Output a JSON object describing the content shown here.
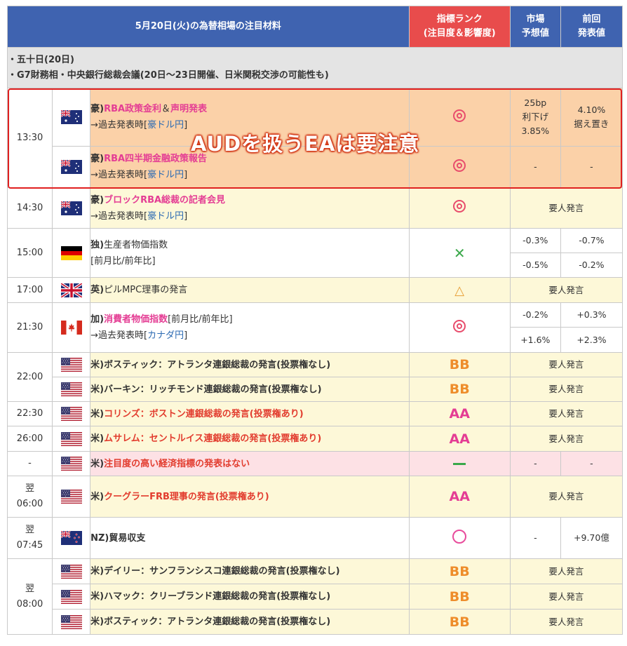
{
  "header": {
    "title": "5月20日(火)の為替相場の注目材料",
    "rank_line1": "指標ランク",
    "rank_line2": "(注目度＆影響度)",
    "forecast_line1": "市場",
    "forecast_line2": "予想値",
    "prev_line1": "前回",
    "prev_line2": "発表値"
  },
  "notes": {
    "line1": "・五十日(20日)",
    "line2": "・G7財務相・中央銀行総裁会議(20日～23日開催、日米関税交渉の可能性も)"
  },
  "overlay_text": "AUDを扱うEAは要注意",
  "events": {
    "rba_rate": {
      "time": "13:30",
      "country": "豪)",
      "title": "RBA政策金利",
      "mid": "＆",
      "title2": "声明発表",
      "sub_pre": "→過去発表時[",
      "sub_link": "豪ドル円",
      "sub_post": "]",
      "forecast": [
        "25bp",
        "利下げ",
        "3.85%"
      ],
      "previous": [
        "4.10%",
        "据え置き"
      ]
    },
    "rba_report": {
      "country": "豪)",
      "title": "RBA四半期金融政策報告",
      "sub_pre": "→過去発表時[",
      "sub_link": "豪ドル円",
      "sub_post": "]",
      "forecast": "-",
      "previous": "-"
    },
    "bullock": {
      "time": "14:30",
      "country": "豪)",
      "title": "ブロックRBA総裁の記者会見",
      "sub_pre": "→過去発表時[",
      "sub_link": "豪ドル円",
      "sub_post": "]",
      "vip": "要人発言"
    },
    "de_ppi": {
      "time": "15:00",
      "country": "独)",
      "title": "生産者物価指数",
      "sub": "[前月比/前年比]",
      "forecast": [
        "-0.3%",
        "-0.5%"
      ],
      "previous": [
        "-0.7%",
        "-0.2%"
      ]
    },
    "uk_pill": {
      "time": "17:00",
      "country": "英)",
      "title": "ピルMPC理事の発言",
      "vip": "要人発言"
    },
    "ca_cpi": {
      "time": "21:30",
      "country": "加)",
      "title": "消費者物価指数",
      "title_suffix": "[前月比/前年比]",
      "sub_pre": "→過去発表時[",
      "sub_link": "カナダ円",
      "sub_post": "]",
      "forecast": [
        "-0.2%",
        "+1.6%"
      ],
      "previous": [
        "+0.3%",
        "+2.3%"
      ]
    },
    "bostic1": {
      "time": "22:00",
      "country": "米)",
      "title": "ボスティック：アトランタ連銀総裁の発言(投票権なし)",
      "rank": "BB",
      "vip": "要人発言"
    },
    "barkin": {
      "country": "米)",
      "title": "バーキン：リッチモンド連銀総裁の発言(投票権なし)",
      "rank": "BB",
      "vip": "要人発言"
    },
    "collins": {
      "time": "22:30",
      "country": "米)",
      "title": "コリンズ：ボストン連銀総裁の発言(投票権あり)",
      "rank": "AA",
      "vip": "要人発言"
    },
    "musalem": {
      "time": "26:00",
      "country": "米)",
      "title": "ムサレム：セントルイス連銀総裁の発言(投票権あり)",
      "rank": "AA",
      "vip": "要人発言"
    },
    "none": {
      "time": "-",
      "country": "米)",
      "title": "注目度の高い経済指標の発表はない",
      "forecast": "-",
      "previous": "-"
    },
    "kugler": {
      "time1": "翌",
      "time2": "06:00",
      "country": "米)",
      "title": "クーグラーFRB理事の発言(投票権あり)",
      "rank": "AA",
      "vip": "要人発言"
    },
    "nz_trade": {
      "time1": "翌",
      "time2": "07:45",
      "country": "NZ)",
      "title": "貿易収支",
      "forecast": "-",
      "previous": "+9.70億"
    },
    "daly": {
      "time1": "翌",
      "time2": "08:00",
      "country": "米)",
      "title": "デイリー：サンフランシスコ連銀総裁の発言(投票権なし)",
      "rank": "BB",
      "vip": "要人発言"
    },
    "hammack": {
      "country": "米)",
      "title": "ハマック：クリーブランド連銀総裁の発言(投票権なし)",
      "rank": "BB",
      "vip": "要人発言"
    },
    "bostic2": {
      "country": "米)",
      "title": "ボスティック：アトランタ連銀総裁の発言(投票権なし)",
      "rank": "BB",
      "vip": "要人発言"
    }
  },
  "colors": {
    "header_bg": "#3f63b0",
    "rank_header_bg": "#e84c4c",
    "highlight_bg": "#fbd1a8",
    "speech_bg": "#fdf8d8",
    "none_bg": "#fde1e5",
    "overlay_border": "#e02020"
  }
}
